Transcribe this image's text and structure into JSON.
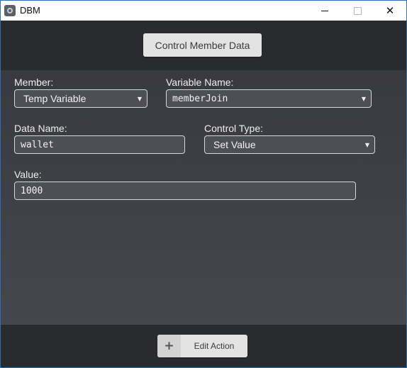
{
  "window": {
    "title": "DBM",
    "minimize_glyph": "",
    "maximize_glyph": "",
    "close_glyph": "✕"
  },
  "header": {
    "button_label": "Control Member Data"
  },
  "form": {
    "member": {
      "label": "Member:",
      "value": "Temp Variable"
    },
    "variable_name": {
      "label": "Variable Name:",
      "value": "memberJoin"
    },
    "data_name": {
      "label": "Data Name:",
      "value": "wallet"
    },
    "control_type": {
      "label": "Control Type:",
      "value": "Set Value"
    },
    "value": {
      "label": "Value:",
      "value": "1000"
    },
    "dropdown_glyph": "▼"
  },
  "footer": {
    "plus_glyph": "+",
    "edit_action_label": "Edit Action"
  },
  "icons": {
    "app": "app-gear-icon",
    "dropdown": "chevron-down-icon",
    "plus": "plus-icon"
  }
}
